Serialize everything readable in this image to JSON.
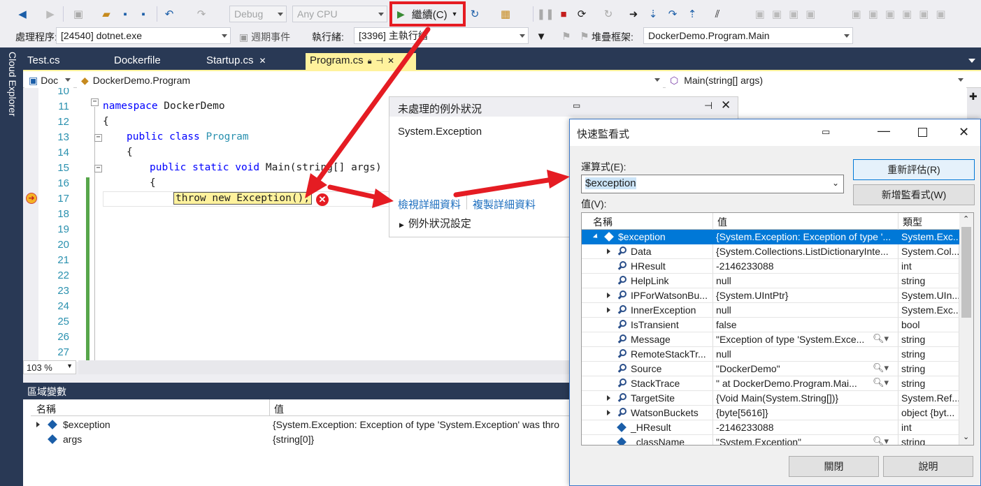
{
  "toolbar1": {
    "config": "Debug",
    "platform": "Any CPU",
    "continue_label": "繼續(C)"
  },
  "toolbar2": {
    "process_label": "處理程序:",
    "process_value": "[24540] dotnet.exe",
    "lifecycle_label": "週期事件",
    "thread_label": "執行緒:",
    "thread_value": "[3396] 主執行緒",
    "stack_label": "堆疊框架:",
    "stack_value": "DockerDemo.Program.Main"
  },
  "side": {
    "cloud_explorer": "Cloud Explorer"
  },
  "tabs": [
    {
      "label": "Test.cs"
    },
    {
      "label": "Dockerfile"
    },
    {
      "label": "Startup.cs"
    },
    {
      "label": "Program.cs"
    }
  ],
  "nav": {
    "project": "Doc",
    "class": "DockerDemo.Program",
    "member": "Main(string[] args)"
  },
  "editor": {
    "line_numbers": [
      "10",
      "11",
      "12",
      "13",
      "14",
      "15",
      "16",
      "17",
      "18",
      "19",
      "20",
      "21",
      "22",
      "23",
      "24",
      "25",
      "26",
      "27"
    ],
    "lines": [
      {
        "kw": "namespace",
        "rest": " DockerDemo"
      },
      {
        "text": "{"
      },
      {
        "kw": "public class",
        "ty": " Program"
      },
      {
        "text": "{"
      },
      {
        "kw": "public static void",
        "rest": " Main(string[] args)"
      },
      {
        "text": "{"
      },
      {
        "text": "throw new Exception();"
      }
    ],
    "zoom": "103 %"
  },
  "exception_popup": {
    "title": "未處理的例外狀況",
    "type": "System.Exception",
    "view_details": "檢視詳細資料",
    "copy_details": "複製詳細資料",
    "settings": "例外狀況設定"
  },
  "locals": {
    "title": "區域變數",
    "col_name": "名稱",
    "col_value": "值",
    "rows": [
      {
        "name": "$exception",
        "value": "{System.Exception: Exception of type 'System.Exception' was thro"
      },
      {
        "name": "args",
        "value": "{string[0]}"
      }
    ]
  },
  "quickwatch": {
    "title": "快速監看式",
    "expr_label": "運算式(E):",
    "expr_value": "$exception",
    "value_label": "值(V):",
    "reevaluate": "重新評估(R)",
    "add_watch": "新增監看式(W)",
    "col_name": "名稱",
    "col_value": "值",
    "col_type": "類型",
    "close": "關閉",
    "help": "說明",
    "rows": [
      {
        "name": "$exception",
        "value": "{System.Exception: Exception of type '...",
        "type": "System.Exc...",
        "icon": "cube"
      },
      {
        "name": "Data",
        "value": "{System.Collections.ListDictionaryInte...",
        "type": "System.Col...",
        "icon": "wrench"
      },
      {
        "name": "HResult",
        "value": "-2146233088",
        "type": "int",
        "icon": "wrench"
      },
      {
        "name": "HelpLink",
        "value": "null",
        "type": "string",
        "icon": "wrench"
      },
      {
        "name": "IPForWatsonBu...",
        "value": "{System.UIntPtr}",
        "type": "System.UIn...",
        "icon": "wrench"
      },
      {
        "name": "InnerException",
        "value": "null",
        "type": "System.Exc...",
        "icon": "wrench"
      },
      {
        "name": "IsTransient",
        "value": "false",
        "type": "bool",
        "icon": "wrench"
      },
      {
        "name": "Message",
        "value": "\"Exception of type 'System.Exce...",
        "type": "string",
        "icon": "wrench"
      },
      {
        "name": "RemoteStackTr...",
        "value": "null",
        "type": "string",
        "icon": "wrench"
      },
      {
        "name": "Source",
        "value": "\"DockerDemo\"",
        "type": "string",
        "icon": "wrench"
      },
      {
        "name": "StackTrace",
        "value": "\"    at DockerDemo.Program.Mai...",
        "type": "string",
        "icon": "wrench"
      },
      {
        "name": "TargetSite",
        "value": "{Void Main(System.String[])}",
        "type": "System.Ref...",
        "icon": "wrench"
      },
      {
        "name": "WatsonBuckets",
        "value": "{byte[5616]}",
        "type": "object {byt...",
        "icon": "wrench"
      },
      {
        "name": "_HResult",
        "value": "-2146233088",
        "type": "int",
        "icon": "cube"
      },
      {
        "name": "_className",
        "value": "\"System.Exception\"",
        "type": "string",
        "icon": "cube"
      }
    ]
  }
}
